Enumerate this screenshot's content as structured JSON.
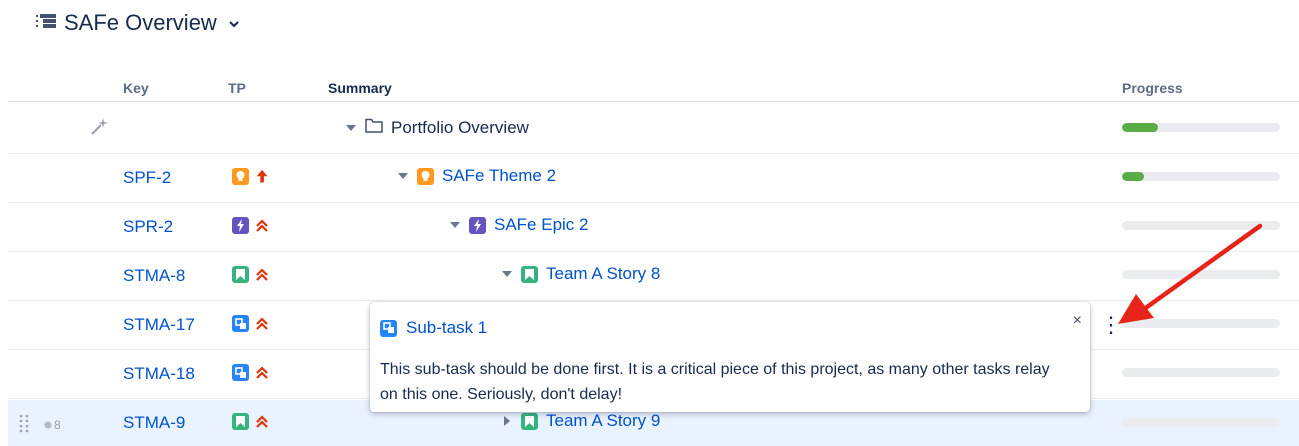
{
  "title": {
    "text": "SAFe Overview",
    "icon": "structure-list-icon",
    "chevron": "˅"
  },
  "columns": {
    "key": "Key",
    "tp": "TP",
    "summary": "Summary",
    "progress": "Progress"
  },
  "rows": [
    {
      "key": "",
      "summary": "Portfolio Overview",
      "progress": 0.23,
      "type": "folder",
      "caret": "down"
    },
    {
      "key": "SPF-2",
      "summary": "SAFe Theme 2",
      "progress": 0.14,
      "type": "theme",
      "priority": "highest",
      "caret": "down"
    },
    {
      "key": "SPR-2",
      "summary": "SAFe Epic 2",
      "progress": 0,
      "type": "epic",
      "priority": "critical",
      "caret": "down"
    },
    {
      "key": "STMA-8",
      "summary": "Team A Story 8",
      "progress": 0,
      "type": "story",
      "priority": "critical",
      "caret": "down"
    },
    {
      "key": "STMA-17",
      "summary": "",
      "progress": 0,
      "type": "subtask",
      "priority": "critical"
    },
    {
      "key": "STMA-18",
      "summary": "",
      "progress": 0,
      "type": "subtask",
      "priority": "critical"
    },
    {
      "key": "STMA-9",
      "summary": "Team A Story 9",
      "progress": 0,
      "type": "story",
      "priority": "critical",
      "caret": "right",
      "badge": "8"
    }
  ],
  "popup": {
    "title": "Sub-task 1",
    "close": "×",
    "body": "This sub-task should be done first. It is a critical piece of this project, as many other tasks relay on this one. Seriously, don't delay!"
  },
  "kebab": "⋮",
  "colors": {
    "link": "#0052cc",
    "theme": "#ff991f",
    "epic": "#6554c0",
    "story": "#36b37e",
    "subtask": "#2684ff",
    "priority": "#de350b",
    "progress": "#5aac44",
    "selected_row": "#e9f2ff"
  }
}
